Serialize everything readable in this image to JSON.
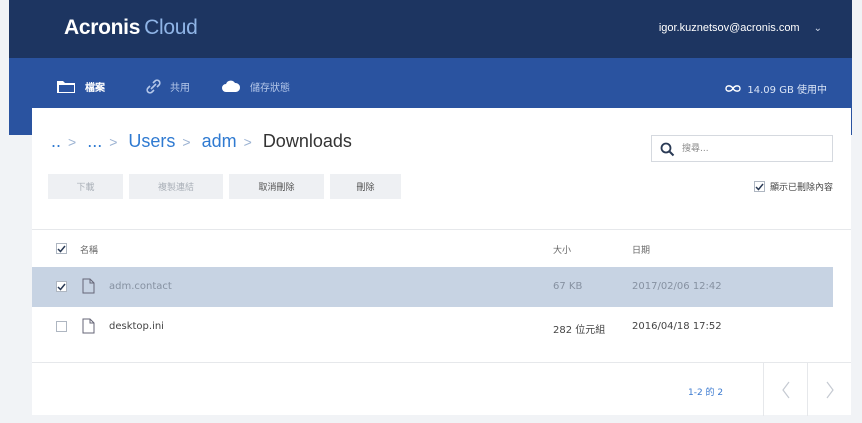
{
  "header": {
    "logo_bold": "Acronis",
    "logo_light": "Cloud",
    "user_email": "igor.kuznetsov@acronis.com"
  },
  "nav": {
    "items": [
      {
        "label": "檔案",
        "icon": "folder-icon",
        "active": true
      },
      {
        "label": "共用",
        "icon": "link-icon",
        "active": false
      },
      {
        "label": "儲存狀態",
        "icon": "cloud-icon",
        "active": false
      }
    ],
    "usage": "14.09 GB 使用中"
  },
  "breadcrumb": [
    "..",
    "...",
    "Users",
    "adm",
    "Downloads"
  ],
  "search": {
    "placeholder": "搜尋..."
  },
  "toolbar": {
    "download": "下載",
    "copy_link": "複製連結",
    "undelete": "取消刪除",
    "delete": "刪除",
    "show_deleted": "顯示已刪除內容"
  },
  "table": {
    "columns": {
      "name": "名稱",
      "size": "大小",
      "date": "日期"
    },
    "rows": [
      {
        "name": "adm.contact",
        "size": "67 KB",
        "date": "2017/02/06 12:42",
        "checked": true
      },
      {
        "name": "desktop.ini",
        "size": "282 位元組",
        "date": "2016/04/18 17:52",
        "checked": false
      }
    ]
  },
  "pager": {
    "text": "1-2 的 2"
  },
  "colors": {
    "topbar": "#1d3561",
    "navbar": "#2a53a0",
    "accent": "#2f7ad1",
    "selected_row": "#c7d3e3"
  }
}
